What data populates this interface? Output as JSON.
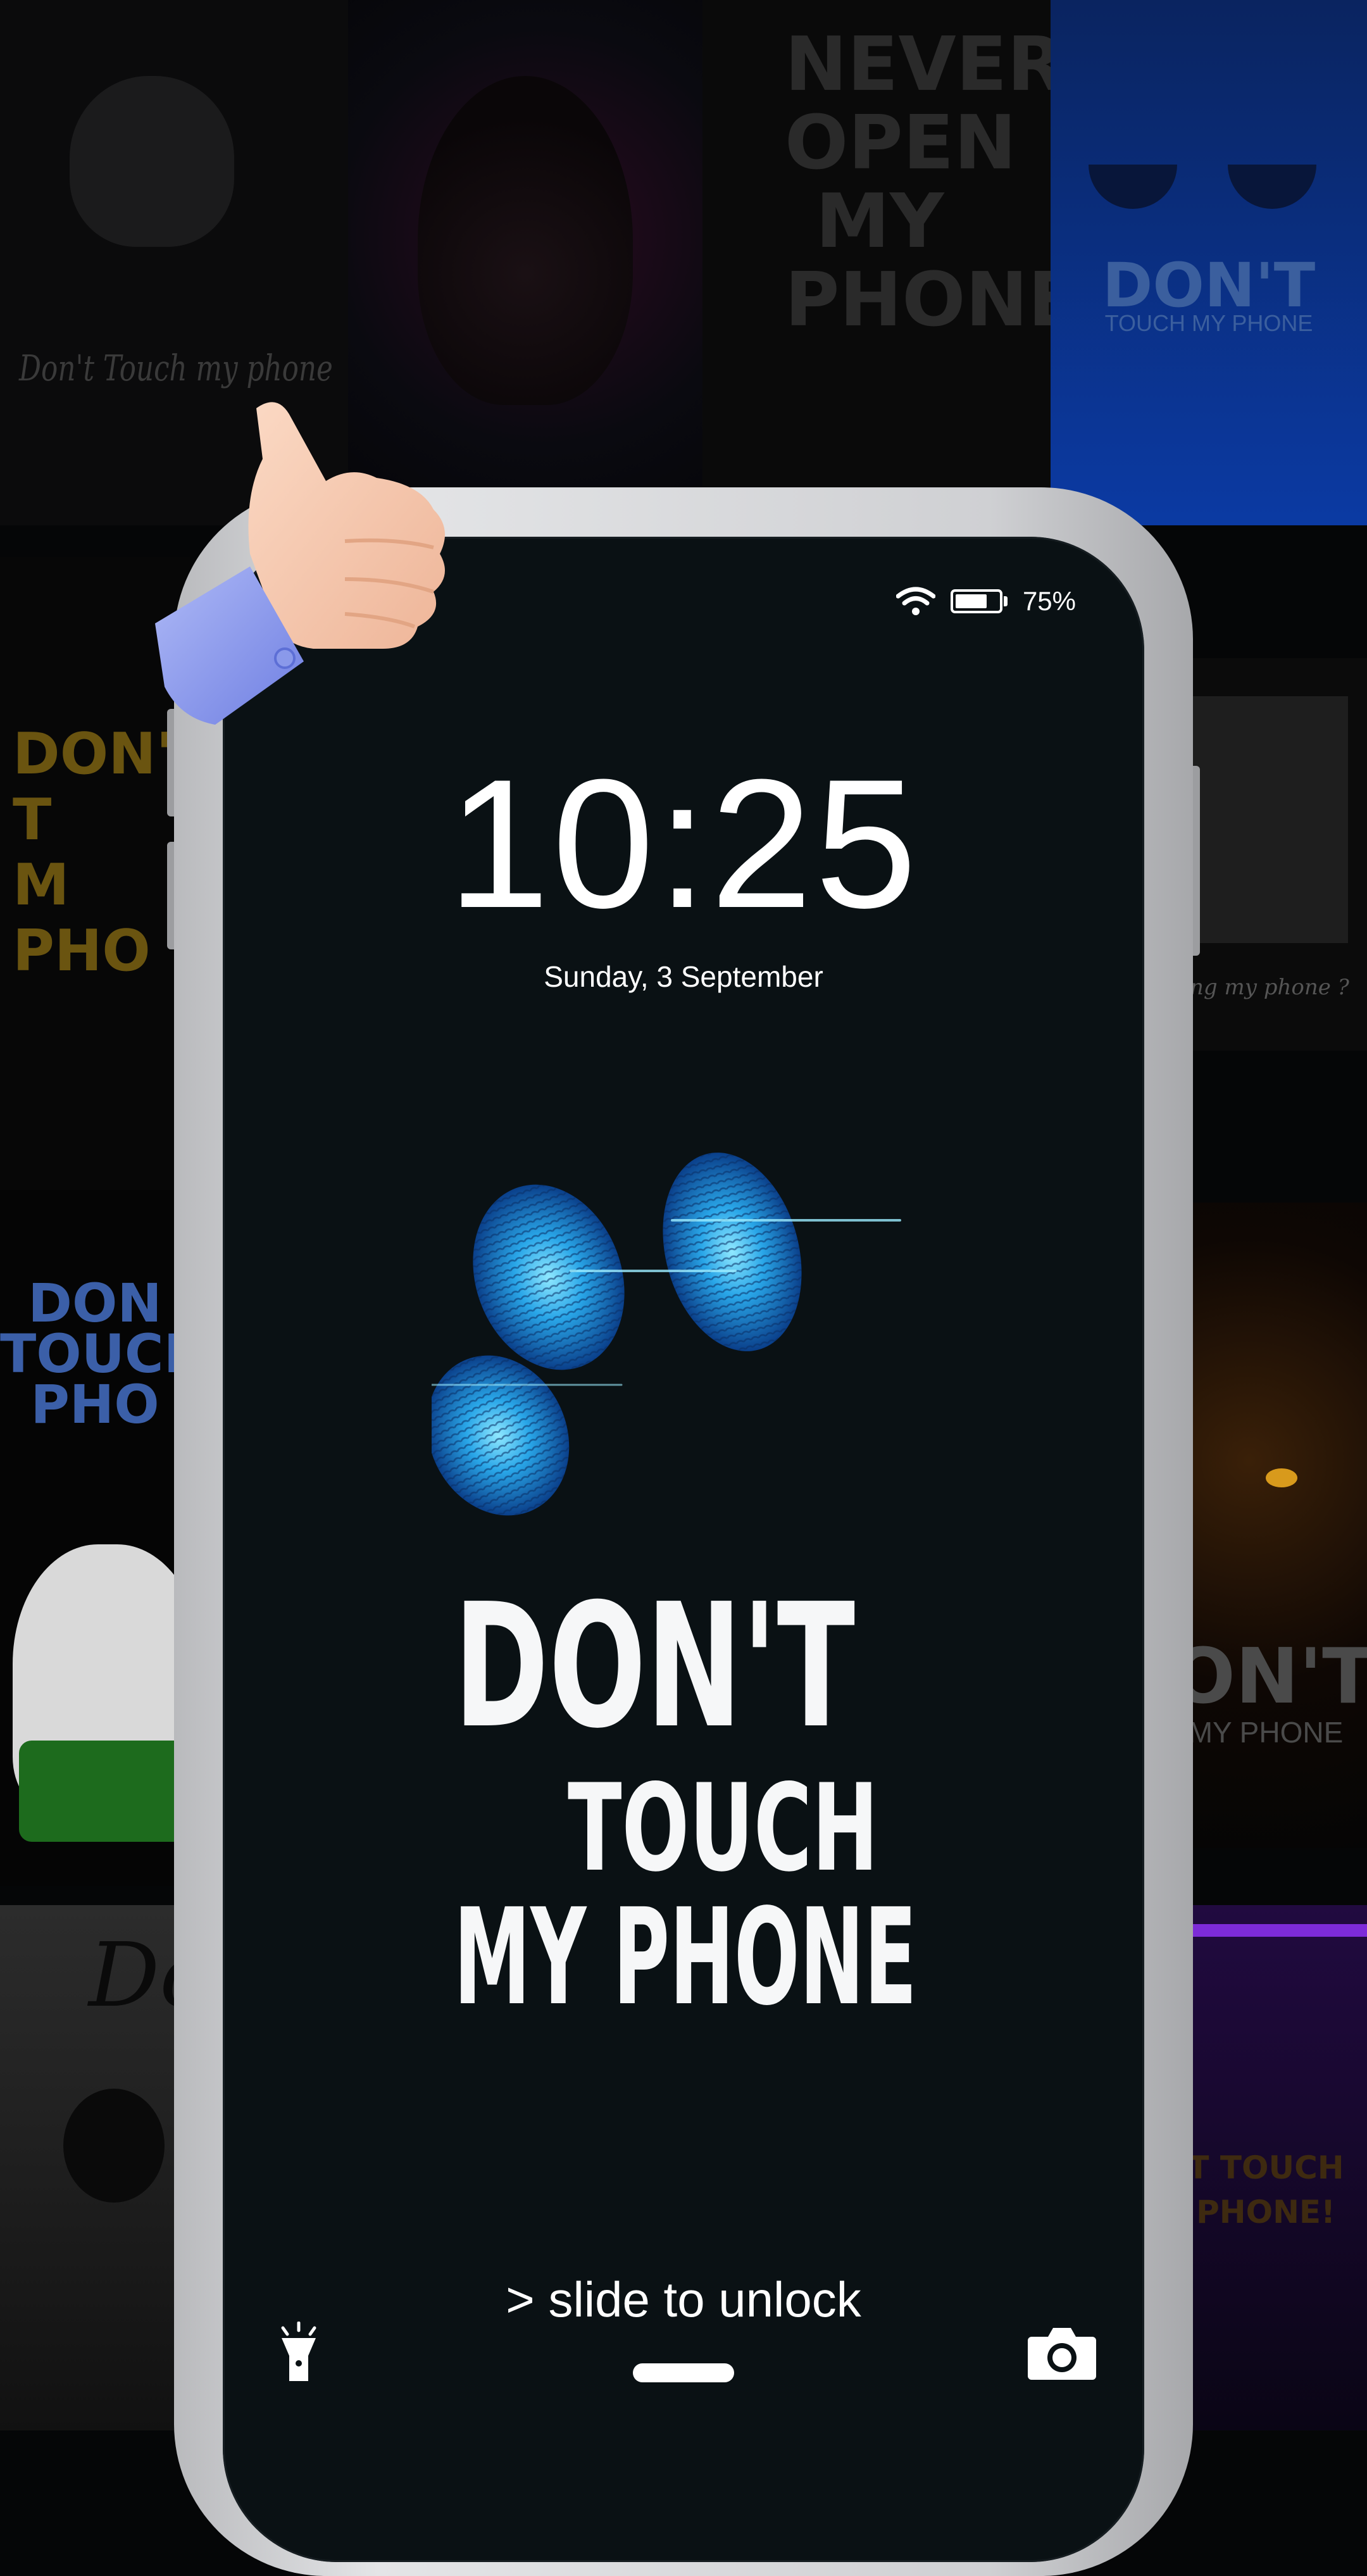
{
  "background_tiles": {
    "tile1": "Don't Touch my phone",
    "tile3": "NEVER\nOPEN\nMY\nPHONE",
    "tile4_title": "DON'T",
    "tile4_sub": "TOUCH MY PHONE",
    "tile5": "DON'T T\nM\nPHO",
    "tile6": "DON\nTOUCH\nPHO",
    "tile7": "Dor",
    "tile8": "ng my phone ?",
    "tile9_title": "ON'T",
    "tile9_sub": "MY PHONE",
    "tile10": "T TOUCH\nPHONE!"
  },
  "status_bar": {
    "wifi_icon": "wifi-icon",
    "battery_icon": "battery-icon",
    "battery_level": 0.75,
    "battery_text": "75%"
  },
  "lockscreen": {
    "time": "10:25",
    "date": "Sunday, 3 September",
    "wallpaper": {
      "line1": "DON'T",
      "line2": "TOUCH",
      "line3": "MY PHONE"
    },
    "slide_hint": "> slide to unlock",
    "left_action_icon": "flashlight-icon",
    "right_action_icon": "camera-icon"
  },
  "colors": {
    "background": "#050607",
    "screen": "#0a1114",
    "phone_frame": "#d8d9db",
    "fingerprint_glow": "#3fd0ff",
    "text": "#ffffff"
  }
}
